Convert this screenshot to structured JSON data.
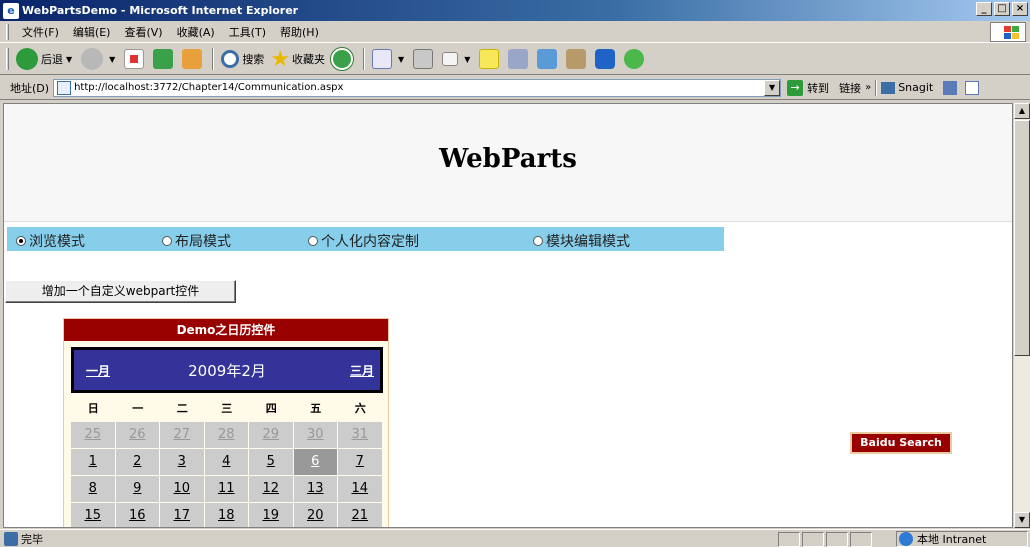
{
  "window": {
    "title": "WebPartsDemo - Microsoft Internet Explorer",
    "min_label": "_",
    "max_label": "□",
    "close_label": "×"
  },
  "menu": {
    "items": [
      "文件(F)",
      "编辑(E)",
      "查看(V)",
      "收藏(A)",
      "工具(T)",
      "帮助(H)"
    ]
  },
  "toolbar": {
    "back_label": "后退",
    "search_label": "搜索",
    "favorites_label": "收藏夹"
  },
  "address": {
    "label": "地址(D)",
    "url": "http://localhost:3772/Chapter14/Communication.aspx",
    "go_label": "转到",
    "links_label": "链接",
    "links_more": "»",
    "snagit_label": "Snagit"
  },
  "page": {
    "title": "WebParts",
    "modes": [
      {
        "label": "浏览模式",
        "checked": true
      },
      {
        "label": "布局模式",
        "checked": false
      },
      {
        "label": "个人化内容定制",
        "checked": false
      },
      {
        "label": "模块编辑模式",
        "checked": false
      }
    ],
    "add_button_label": "增加一个自定义webpart控件",
    "calendar": {
      "part_title": "Demo之日历控件",
      "prev_label": "一月",
      "next_label": "三月",
      "month_label": "2009年2月",
      "weekdays": [
        "日",
        "一",
        "二",
        "三",
        "四",
        "五",
        "六"
      ],
      "weeks": [
        [
          {
            "d": "25",
            "other": true
          },
          {
            "d": "26",
            "other": true
          },
          {
            "d": "27",
            "other": true
          },
          {
            "d": "28",
            "other": true
          },
          {
            "d": "29",
            "other": true
          },
          {
            "d": "30",
            "other": true
          },
          {
            "d": "31",
            "other": true
          }
        ],
        [
          {
            "d": "1"
          },
          {
            "d": "2"
          },
          {
            "d": "3"
          },
          {
            "d": "4"
          },
          {
            "d": "5"
          },
          {
            "d": "6",
            "today": true
          },
          {
            "d": "7"
          }
        ],
        [
          {
            "d": "8"
          },
          {
            "d": "9"
          },
          {
            "d": "10"
          },
          {
            "d": "11"
          },
          {
            "d": "12"
          },
          {
            "d": "13"
          },
          {
            "d": "14"
          }
        ],
        [
          {
            "d": "15"
          },
          {
            "d": "16"
          },
          {
            "d": "17"
          },
          {
            "d": "18"
          },
          {
            "d": "19"
          },
          {
            "d": "20"
          },
          {
            "d": "21"
          }
        ]
      ]
    },
    "baidu_label": "Baidu Search"
  },
  "status": {
    "text": "完毕",
    "zone_label": "本地 Intranet"
  },
  "colors": {
    "calendar_title_bg": "#990000",
    "calendar_header_bg": "#333399",
    "mode_bar_bg": "#87ceeb",
    "day_cell_bg": "#cccccc",
    "today_bg": "#999999"
  }
}
